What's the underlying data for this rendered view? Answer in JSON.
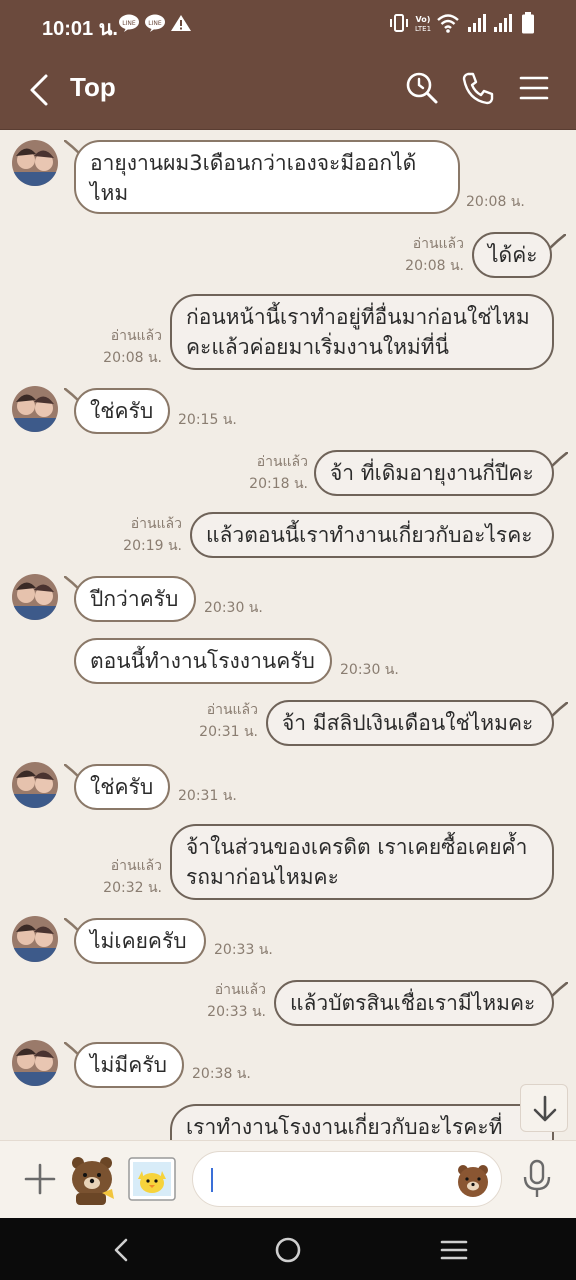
{
  "status_bar": {
    "time": "10:01 น.",
    "notifications": [
      "line-icon",
      "line-icon",
      "warning-icon"
    ],
    "system_icons": [
      "vibrate-icon",
      "volte-icon",
      "wifi-icon",
      "signal-icon",
      "signal-icon",
      "battery-icon"
    ]
  },
  "header": {
    "title": "Top",
    "icons": [
      "back-icon",
      "search-clock-icon",
      "phone-icon",
      "menu-icon"
    ]
  },
  "messages": [
    {
      "dir": "in",
      "lines": [
        "อายุงานผม3เดือนกว่าเองจะมีออกได้",
        "ไหม"
      ],
      "time": "20:08 น."
    },
    {
      "dir": "out",
      "lines": [
        "ได้ค่ะ"
      ],
      "read": "อ่านแล้ว",
      "time": "20:08 น."
    },
    {
      "dir": "out",
      "lines": [
        "ก่อนหน้านี้เราทำอยู่ที่อื่นมาก่อนใช่ไหม",
        "คะแล้วค่อยมาเริ่มงานใหม่ที่นี่"
      ],
      "read": "อ่านแล้ว",
      "time": "20:08 น."
    },
    {
      "dir": "in",
      "lines": [
        "ใช่ครับ"
      ],
      "time": "20:15 น."
    },
    {
      "dir": "out",
      "lines": [
        "จ้า ที่เดิมอายุงานกี่ปีคะ"
      ],
      "read": "อ่านแล้ว",
      "time": "20:18 น."
    },
    {
      "dir": "out",
      "lines": [
        "แล้วตอนนี้เราทำงานเกี่ยวกับอะไรคะ"
      ],
      "read": "อ่านแล้ว",
      "time": "20:19 น."
    },
    {
      "dir": "in",
      "lines": [
        "ปีกว่าครับ"
      ],
      "time": "20:30 น."
    },
    {
      "dir": "in",
      "lines": [
        "ตอนนี้ทำงานโรงงานครับ"
      ],
      "time": "20:30 น."
    },
    {
      "dir": "out",
      "lines": [
        "จ้า มีสลิปเงินเดือนใช่ไหมคะ"
      ],
      "read": "อ่านแล้ว",
      "time": "20:31 น."
    },
    {
      "dir": "in",
      "lines": [
        "ใช่ครับ"
      ],
      "time": "20:31 น."
    },
    {
      "dir": "out",
      "lines": [
        "จ้าในส่วนของเครดิต เราเคยซื้อเคยค้ำ",
        "รถมาก่อนไหมคะ"
      ],
      "read": "อ่านแล้ว",
      "time": "20:32 น."
    },
    {
      "dir": "in",
      "lines": [
        "ไม่เคยครับ"
      ],
      "time": "20:33 น."
    },
    {
      "dir": "out",
      "lines": [
        "แล้วบัตรสินเชื่อเรามีไหมคะ"
      ],
      "read": "อ่านแล้ว",
      "time": "20:33 น."
    },
    {
      "dir": "in",
      "lines": [
        "ไม่มีครับ"
      ],
      "time": "20:38 น."
    },
    {
      "dir": "out",
      "lines": [
        "เราทำงานโรงงานเกี่ยวกับอะไรคะที่"
      ],
      "read": "",
      "time": ""
    }
  ],
  "input": {
    "placeholder": "",
    "value": ""
  },
  "colors": {
    "header_bg": "#6b4a3d",
    "chat_bg": "#f2ede6",
    "bubble_in": "#ffffff",
    "bubble_out": "#f4f0ec",
    "bubble_border": "#8a7868",
    "meta_text": "#8a7d71"
  }
}
